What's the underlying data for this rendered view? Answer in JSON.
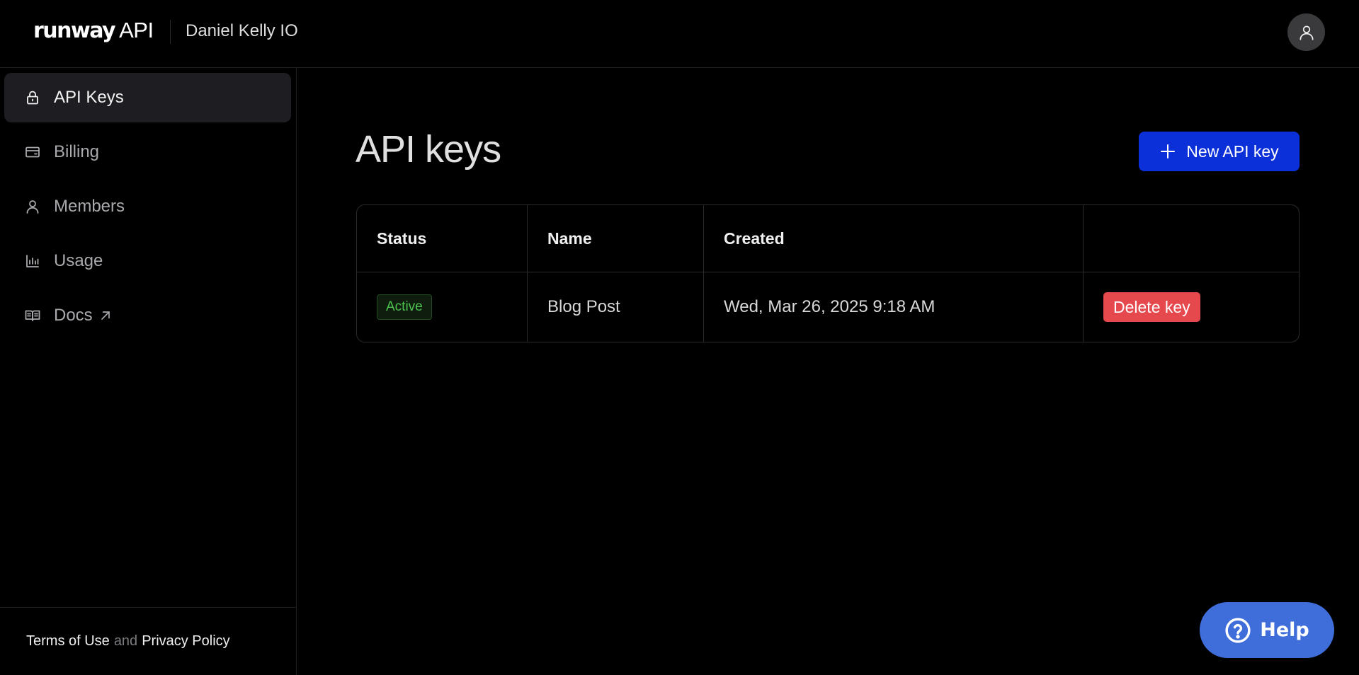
{
  "header": {
    "logo_brand": "runway",
    "logo_api": "API",
    "org_name": "Daniel Kelly IO",
    "avatar_icon": "user-icon"
  },
  "sidebar": {
    "items": [
      {
        "label": "API Keys",
        "icon": "lock-icon",
        "active": true
      },
      {
        "label": "Billing",
        "icon": "credit-card-icon",
        "active": false
      },
      {
        "label": "Members",
        "icon": "user-icon",
        "active": false
      },
      {
        "label": "Usage",
        "icon": "bar-chart-icon",
        "active": false
      },
      {
        "label": "Docs",
        "icon": "book-icon",
        "active": false,
        "external": true
      }
    ],
    "footer": {
      "terms": "Terms of Use",
      "and": "and",
      "privacy": "Privacy Policy"
    }
  },
  "main": {
    "title": "API keys",
    "new_key_label": "New API key",
    "table": {
      "columns": [
        "Status",
        "Name",
        "Created",
        ""
      ],
      "rows": [
        {
          "status": "Active",
          "name": "Blog Post",
          "created": "Wed, Mar 26, 2025 9:18 AM",
          "action": "Delete key"
        }
      ]
    }
  },
  "help": {
    "label": "Help"
  },
  "colors": {
    "background": "#000000",
    "primary_button": "#0b2fd8",
    "danger_button": "#e5484d",
    "active_badge": "#4ec24e",
    "help_button": "#3f6edb",
    "sidebar_active": "#1e1e22"
  }
}
